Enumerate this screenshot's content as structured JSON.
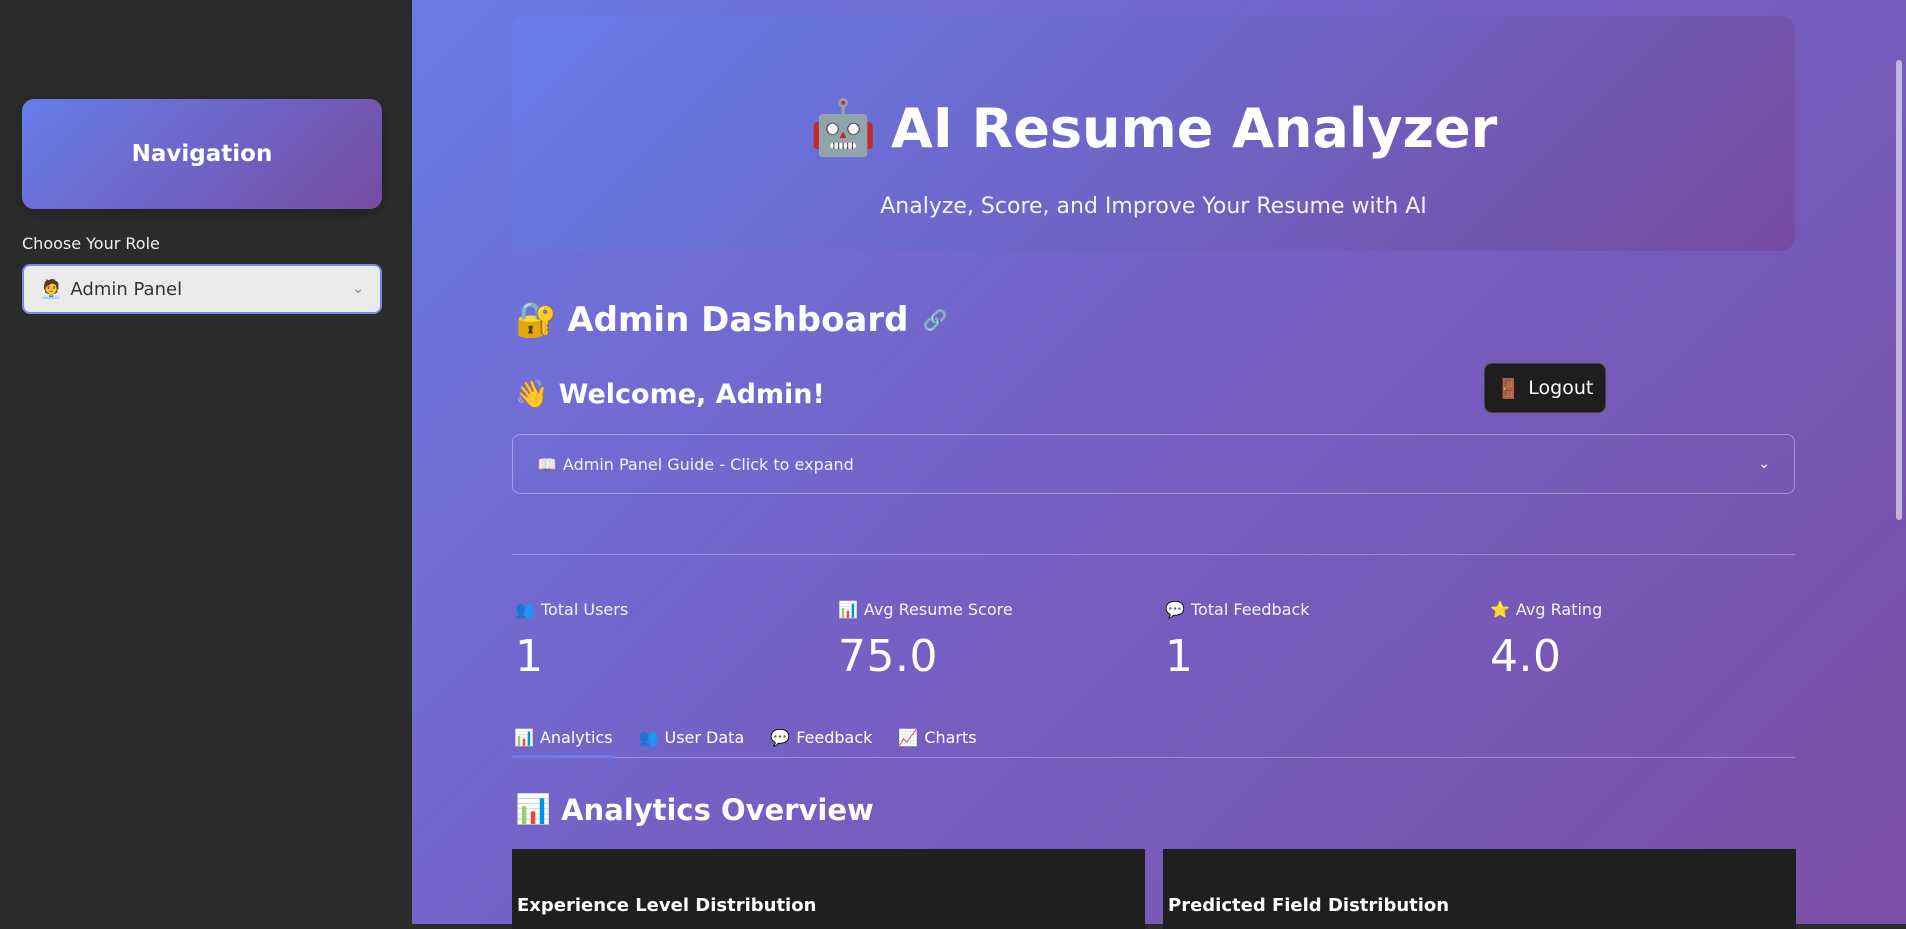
{
  "sidebar": {
    "nav_title": "Navigation",
    "role_label": "Choose Your Role",
    "role_selected": "Admin Panel",
    "role_emoji": "🧑‍💼"
  },
  "hero": {
    "title": "AI Resume Analyzer",
    "emoji": "🤖",
    "subtitle": "Analyze, Score, and Improve Your Resume with AI"
  },
  "dashboard": {
    "title": "Admin Dashboard",
    "title_emoji": "🔐",
    "link_icon": "🔗",
    "welcome": "Welcome, Admin!",
    "welcome_emoji": "👋",
    "logout_label": "Logout",
    "logout_emoji": "🚪",
    "guide": "Admin Panel Guide - Click to expand",
    "guide_emoji": "📖"
  },
  "metrics": [
    {
      "emoji": "👥",
      "label": "Total Users",
      "value": "1"
    },
    {
      "emoji": "📊",
      "label": "Avg Resume Score",
      "value": "75.0"
    },
    {
      "emoji": "💬",
      "label": "Total Feedback",
      "value": "1"
    },
    {
      "emoji": "⭐",
      "label": "Avg Rating",
      "value": "4.0"
    }
  ],
  "tabs": [
    {
      "emoji": "📊",
      "label": "Analytics"
    },
    {
      "emoji": "👥",
      "label": "User Data"
    },
    {
      "emoji": "💬",
      "label": "Feedback"
    },
    {
      "emoji": "📈",
      "label": "Charts"
    }
  ],
  "analytics": {
    "title": "Analytics Overview",
    "emoji": "📊",
    "panels": [
      {
        "title": "Experience Level Distribution"
      },
      {
        "title": "Predicted Field Distribution"
      }
    ]
  },
  "colors": {
    "accent": "#667eea",
    "accent2": "#764ba2",
    "sidebar_bg": "#2b2b2b"
  }
}
